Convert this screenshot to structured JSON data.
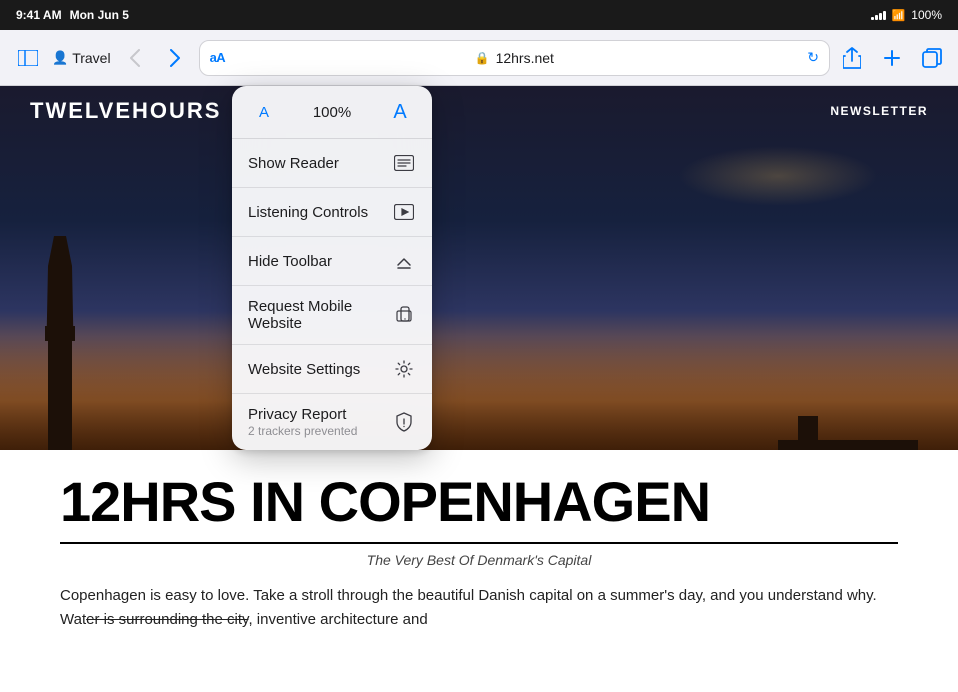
{
  "statusBar": {
    "time": "9:41 AM",
    "day": "Mon Jun 5",
    "wifi": "WiFi",
    "battery": "100%"
  },
  "browserChrome": {
    "sidebarIcon": "⊡",
    "tabLabel": "Travel",
    "userIcon": "👤",
    "backIcon": "‹",
    "forwardIcon": "›",
    "addressBar": {
      "aaLabel": "aA",
      "lockIcon": "🔒",
      "url": "12hrs.net"
    },
    "screenshotIcon": "⊡",
    "reloadIcon": "↻",
    "shareIcon": "⬆",
    "newTabIcon": "+",
    "tabsIcon": "⊡"
  },
  "siteNav": {
    "logo": "TWELVEHOURS",
    "links": [
      "NEWSLETTER"
    ]
  },
  "dropdown": {
    "fontSmall": "A",
    "fontPct": "100%",
    "fontLarge": "A",
    "items": [
      {
        "label": "Show Reader",
        "sublabel": "",
        "icon": "reader"
      },
      {
        "label": "Listening Controls",
        "sublabel": "",
        "icon": "listening"
      },
      {
        "label": "Hide Toolbar",
        "sublabel": "",
        "icon": "toolbar"
      },
      {
        "label": "Request Mobile Website",
        "sublabel": "",
        "icon": "mobile"
      },
      {
        "label": "Website Settings",
        "sublabel": "",
        "icon": "settings"
      },
      {
        "label": "Privacy Report",
        "sublabel": "2 trackers prevented",
        "icon": "privacy"
      }
    ]
  },
  "article": {
    "title": "12HRS IN COPENHAGEN",
    "subtitle": "The Very Best Of Denmark's Capital",
    "bodyStart": "Copenhagen is easy to love. Take a stroll through the beautiful Danish capital on a summer's day, and you understand why. Wat",
    "bodyStrike": "er is surrounding the city",
    "bodyEnd": ", inventive architecture and"
  }
}
